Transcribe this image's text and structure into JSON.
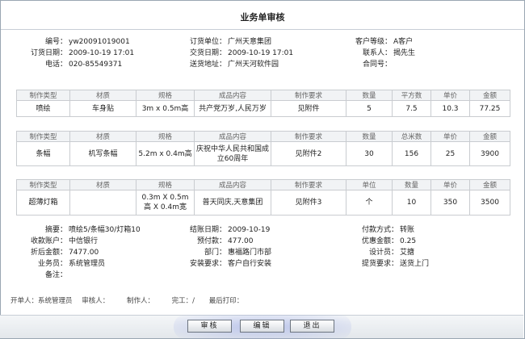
{
  "title": "业务单审核",
  "header": {
    "rows": [
      [
        {
          "label": "编号：",
          "value": "yw20091019001"
        },
        {
          "label": "订货单位：",
          "value": "广州天意集团"
        },
        {
          "label": "客户等级：",
          "value": "A客户"
        }
      ],
      [
        {
          "label": "订货日期：",
          "value": "2009-10-19 17:01"
        },
        {
          "label": "交货日期：",
          "value": "2009-10-19 17:01"
        },
        {
          "label": "联系人：",
          "value": "揭先生"
        }
      ],
      [
        {
          "label": "电话：",
          "value": "020-85549371"
        },
        {
          "label": "送货地址：",
          "value": "广州天河软件园"
        },
        {
          "label": "合同号：",
          "value": ""
        }
      ]
    ]
  },
  "tables": [
    {
      "headers": [
        "制作类型",
        "材质",
        "规格",
        "成品内容",
        "制作要求",
        "数量",
        "平方数",
        "单价",
        "金额"
      ],
      "rows": [
        [
          "喷绘",
          "车身贴",
          "3m x 0.5m高",
          "共产党万岁,人民万岁",
          "见附件",
          "5",
          "7.5",
          "10.3",
          "77.25"
        ]
      ]
    },
    {
      "headers": [
        "制作类型",
        "材质",
        "规格",
        "成品内容",
        "制作要求",
        "数量",
        "总米数",
        "单价",
        "金额"
      ],
      "rows": [
        [
          "条幅",
          "机写条幅",
          "5.2m x 0.4m高",
          "庆祝中华人民共和国成立60周年",
          "见附件2",
          "30",
          "156",
          "25",
          "3900"
        ]
      ]
    },
    {
      "headers": [
        "制作类型",
        "材质",
        "规格",
        "成品内容",
        "制作要求",
        "单位",
        "数量",
        "单价",
        "金额"
      ],
      "rows": [
        [
          "超薄灯箱",
          "",
          "0.3m X 0.5m高 X 0.4m宽",
          "普天同庆,天意集团",
          "见附件3",
          "个",
          "10",
          "350",
          "3500"
        ]
      ]
    }
  ],
  "summary": {
    "rows": [
      [
        {
          "label": "摘要：",
          "value": "喷绘5/条幅30/灯箱10"
        },
        {
          "label": "结账日期：",
          "value": "2009-10-19"
        },
        {
          "label": "付款方式：",
          "value": "转账"
        }
      ],
      [
        {
          "label": "收款账户：",
          "value": "中信银行"
        },
        {
          "label": "预付款：",
          "value": "477.00"
        },
        {
          "label": "优惠金额：",
          "value": "0.25"
        }
      ],
      [
        {
          "label": "折后金额：",
          "value": "7477.00"
        },
        {
          "label": "部门：",
          "value": "惠福路门市部"
        },
        {
          "label": "设计员：",
          "value": "艾搪"
        }
      ],
      [
        {
          "label": "业务员：",
          "value": "系统管理员"
        },
        {
          "label": "安装要求：",
          "value": "客户自行安装"
        },
        {
          "label": "提货要求：",
          "value": "送货上门"
        }
      ],
      [
        {
          "label": "备注：",
          "value": ""
        }
      ]
    ]
  },
  "footer": {
    "creator": "开单人：系统管理员",
    "auditor": "审核人：",
    "maker": "制作人：",
    "finish": "完工：/",
    "last_print": "最后打印："
  },
  "buttons": {
    "audit": "审核",
    "edit": "编辑",
    "exit": "退出"
  }
}
